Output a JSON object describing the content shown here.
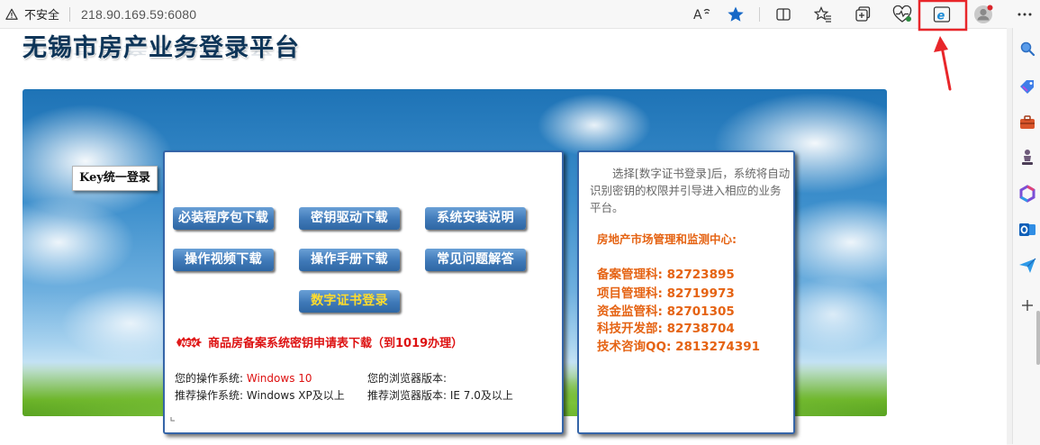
{
  "browser": {
    "security_label": "不安全",
    "url": "218.90.169.59:6080"
  },
  "site": {
    "title": "无锡市房产业务登录平台",
    "key_tab": "Key统一登录"
  },
  "buttons": {
    "installer": "必装程序包下载",
    "key_driver": "密钥驱动下载",
    "install_guide": "系统安装说明",
    "video": "操作视频下载",
    "manual": "操作手册下载",
    "faq": "常见问题解答",
    "cert_login": "数字证书登录"
  },
  "notice": {
    "badge": "NEW",
    "text": "商品房备案系统密钥申请表下载（到1019办理）"
  },
  "system": {
    "os_label": "您的操作系统:",
    "os_value": "Windows 10",
    "browser_label": "您的浏览器版本:",
    "browser_value": "",
    "rec_os_label": "推荐操作系统:",
    "rec_os_value": "Windows XP及以上",
    "rec_browser_label": "推荐浏览器版本:",
    "rec_browser_value": "IE 7.0及以上"
  },
  "info": {
    "description": "选择[数字证书登录]后，系统将自动识别密钥的权限并引导进入相应的业务平台。",
    "center": "房地产市场管理和监测中心:",
    "contacts": [
      {
        "label": "备案管理科:",
        "value": "82723895"
      },
      {
        "label": "项目管理科:",
        "value": "82719973"
      },
      {
        "label": "资金监管科:",
        "value": "82701305"
      },
      {
        "label": "科技开发部:",
        "value": "82738704"
      },
      {
        "label": "技术咨询QQ:",
        "value": "2813274391"
      }
    ]
  },
  "colors": {
    "accent_orange": "#e56313",
    "notice_red": "#dd1111",
    "button_blue": "#3f79b8",
    "annotation_red": "#e8262a"
  }
}
